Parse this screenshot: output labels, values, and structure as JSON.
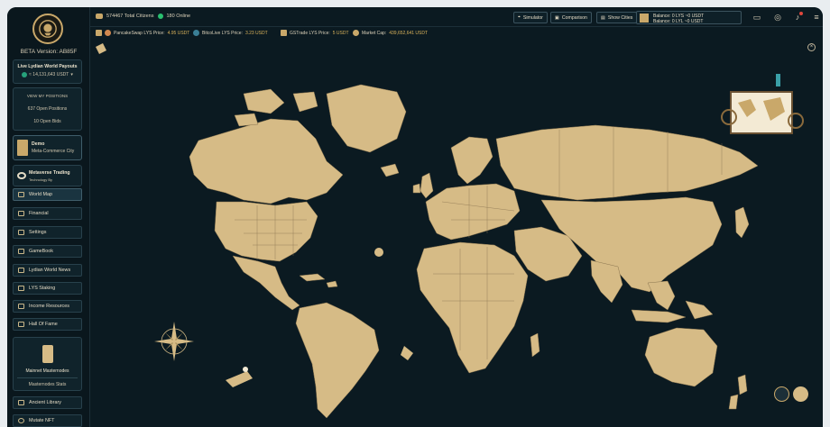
{
  "app": {
    "beta_version": "BETA Version: AB85F",
    "accent": "#c9a86a",
    "land_color": "#d6bb86",
    "bg_color": "#0b1a21"
  },
  "sidebar": {
    "payouts": {
      "title": "Live Lydian World Payouts",
      "amount": "≈ 14,131,643 USDT"
    },
    "positions": {
      "view_label": "VIEW MY POSITIONS",
      "open_positions": "637 Open Positions",
      "open_bids": "10 Open Bids"
    },
    "demo": {
      "title": "Demo",
      "subtitle": "Meta-Commerce City"
    },
    "trading": {
      "title": "Metaverse Trading",
      "subtitle": "Technology By"
    },
    "items": [
      {
        "label": "World Map",
        "icon": "map-icon"
      },
      {
        "label": "Financial",
        "icon": "financial-icon"
      },
      {
        "label": "Settings",
        "icon": "settings-icon"
      },
      {
        "label": "GameBook",
        "icon": "book-icon"
      },
      {
        "label": "Lydian World News",
        "icon": "news-icon"
      },
      {
        "label": "LYS Staking",
        "icon": "staking-icon"
      },
      {
        "label": "Income Resources",
        "icon": "chart-icon"
      },
      {
        "label": "Hall Of Fame",
        "icon": "trophy-icon"
      }
    ],
    "masternodes": {
      "title": "Mainnet Masternodes",
      "stats": "Masternodes Stats"
    },
    "bottom_items": [
      {
        "label": "Ancient Library",
        "icon": "library-icon"
      },
      {
        "label": "Mutate NFT",
        "icon": "mutate-icon"
      }
    ]
  },
  "topbar": {
    "citizens": "574467 Total Citizens",
    "online": "180  Online",
    "buttons": {
      "simulator": "Simulator",
      "comparison": "Comparison",
      "show_cities": "Show Cities"
    },
    "balance_lys": "Balance: 0 LYS ~0 USDT",
    "balance_lyl": "Balance: 0 LYL ~0 USDT"
  },
  "ticker": {
    "pancakeswap_label": "PancakeSwap LYS Price:",
    "pancakeswap_price": "4.95 USDT",
    "bitcoinlive_label": "BitcoLive LYS Price:",
    "bitcoinlive_price": "3.23 USDT",
    "gstrade_label": "GSTrade LYS Price:",
    "gstrade_price": "5 USDT",
    "marketcap_label": "Market Cap:",
    "marketcap_value": "439,652,641 USDT"
  }
}
